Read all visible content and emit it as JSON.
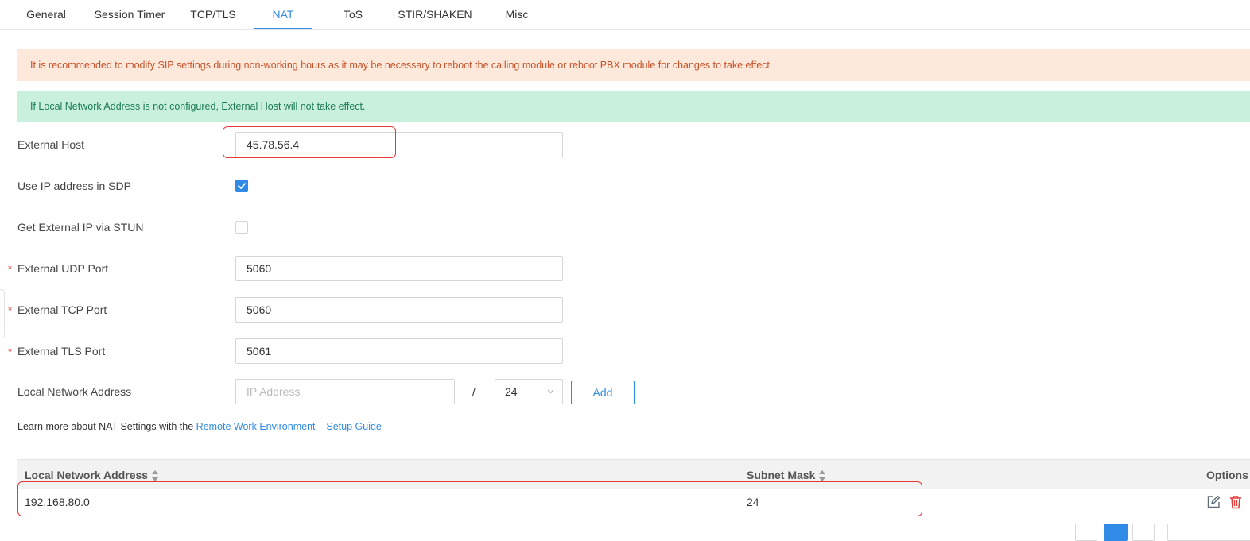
{
  "tabs": [
    {
      "label": "General"
    },
    {
      "label": "Session Timer"
    },
    {
      "label": "TCP/TLS"
    },
    {
      "label": "NAT"
    },
    {
      "label": "ToS"
    },
    {
      "label": "STIR/SHAKEN"
    },
    {
      "label": "Misc"
    }
  ],
  "active_tab": "NAT",
  "alerts": {
    "warning": "It is recommended to modify SIP settings during non-working hours as it may be necessary to reboot the calling module or reboot PBX module for changes to take effect.",
    "info": "If Local Network Address is not configured, External Host will not take effect."
  },
  "form": {
    "external_host": {
      "label": "External Host",
      "value": "45.78.56.4"
    },
    "use_ip_in_sdp": {
      "label": "Use IP address in SDP",
      "checked": true
    },
    "stun": {
      "label": "Get External IP via STUN",
      "checked": false
    },
    "udp_port": {
      "label": "External UDP Port",
      "value": "5060",
      "required": "*"
    },
    "tcp_port": {
      "label": "External TCP Port",
      "value": "5060",
      "required": "*"
    },
    "tls_port": {
      "label": "External TLS Port",
      "value": "5061",
      "required": "*"
    },
    "local_network": {
      "label": "Local Network Address",
      "placeholder": "IP Address",
      "separator": "/",
      "mask": "24",
      "add_label": "Add"
    }
  },
  "learn_more": {
    "text": "Learn more about NAT Settings with the ",
    "link": "Remote Work Environment – Setup Guide"
  },
  "table": {
    "columns": [
      "Local Network Address",
      "Subnet Mask",
      "Options"
    ],
    "rows": [
      {
        "address": "192.168.80.0",
        "mask": "24"
      }
    ]
  },
  "colors": {
    "accent": "#2f8be6",
    "danger": "#e53935",
    "warning_bg": "#fde9db",
    "success_bg": "#c9f0dd"
  }
}
